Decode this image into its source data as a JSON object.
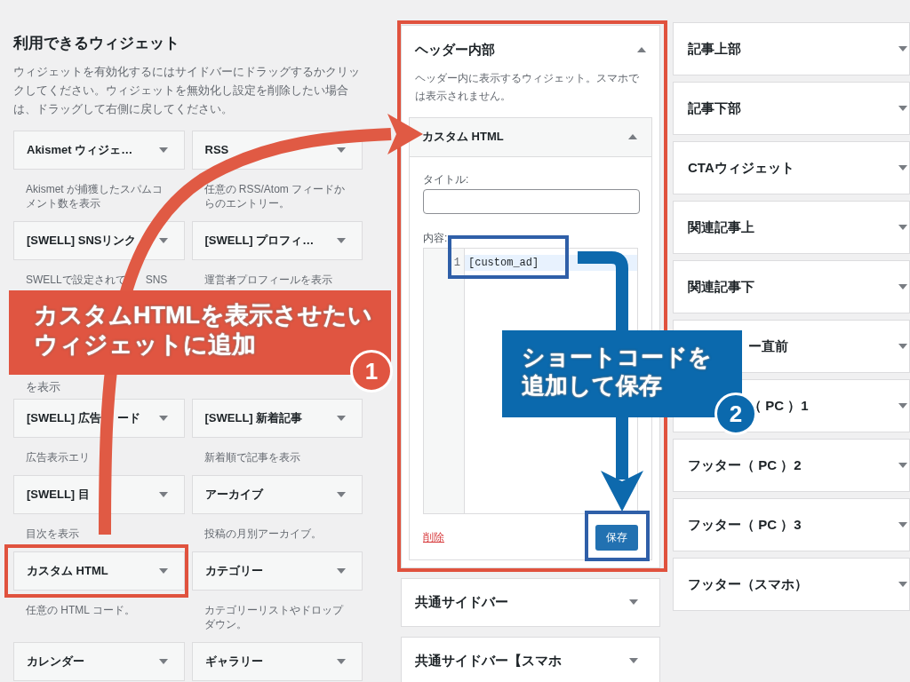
{
  "available_widgets": {
    "title": "利用できるウィジェット",
    "intro": "ウィジェットを有効化するにはサイドバーにドラッグするかクリックしてください。ウィジェットを無効化し設定を削除したい場合は、ドラッグして右側に戻してください。",
    "rows": [
      {
        "items": [
          {
            "title": "Akismet ウィジェ…",
            "description": "Akismet が捕獲したスパムコメント数を表示"
          },
          {
            "title": "RSS",
            "description": "任意の RSS/Atom フィードからのエントリー。"
          }
        ]
      },
      {
        "items": [
          {
            "title": "[SWELL] SNSリンク",
            "description": "SWELLで設定されて",
            "description_tail": "SNS"
          },
          {
            "title": "[SWELL] プロフィ…",
            "description": "運営者プロフィールを表示"
          }
        ]
      },
      {
        "kind": "fragment",
        "text": "を表示"
      },
      {
        "items": [
          {
            "title": "[SWELL] 広告",
            "title_tail": "ード",
            "description": "広告表示エリ"
          },
          {
            "title": "[SWELL] 新着記事",
            "description": "新着順で記事を表示"
          }
        ]
      },
      {
        "items": [
          {
            "title": "[SWELL] 目",
            "description": "目次を表示"
          },
          {
            "title": "アーカイブ",
            "description": "投稿の月別アーカイブ。"
          }
        ]
      },
      {
        "items": [
          {
            "title": "カスタム HTML",
            "description": "任意の HTML コード。",
            "highlighted": true
          },
          {
            "title": "カテゴリー",
            "description": "カテゴリーリストやドロップダウン。"
          }
        ]
      },
      {
        "items": [
          {
            "title": "カレンダー"
          },
          {
            "title": "ギャラリー"
          }
        ]
      }
    ]
  },
  "header_area": {
    "title": "ヘッダー内部",
    "description": "ヘッダー内に表示するウィジェット。スマホでは表示されません。",
    "highlighted": true,
    "widget": {
      "title": "カスタム HTML",
      "expanded": true,
      "title_label": "タイトル:",
      "content_label": "内容:",
      "code_lines": [
        {
          "number": "1",
          "text": "[custom_ad]"
        }
      ],
      "delete_link": "削除",
      "save_button": "保存"
    }
  },
  "middle_areas": [
    {
      "title": "共通サイドバー"
    },
    {
      "title": "共通サイドバー【スマホ"
    }
  ],
  "right_areas": [
    {
      "kind": "full",
      "title": "記事上部"
    },
    {
      "kind": "full",
      "title": "記事下部"
    },
    {
      "kind": "full",
      "title": "CTAウィジェット"
    },
    {
      "kind": "full",
      "title": "関連記事上"
    },
    {
      "kind": "full",
      "title": "関連記事下"
    },
    {
      "kind": "covered",
      "title": "ー直前"
    },
    {
      "kind": "covered",
      "title": "（ PC ）1"
    },
    {
      "kind": "full",
      "title": "フッター（ PC ）2"
    },
    {
      "kind": "full",
      "title": "フッター（ PC ）3"
    },
    {
      "kind": "full",
      "title": "フッター（スマホ）"
    }
  ],
  "annotations": [
    {
      "kind": "red",
      "lines": [
        "カスタムHTMLを表示させたい",
        "ウィジェットに追加"
      ],
      "step": "1"
    },
    {
      "kind": "blue",
      "lines": [
        "ショートコードを",
        "追加して保存"
      ],
      "step": "2"
    }
  ]
}
